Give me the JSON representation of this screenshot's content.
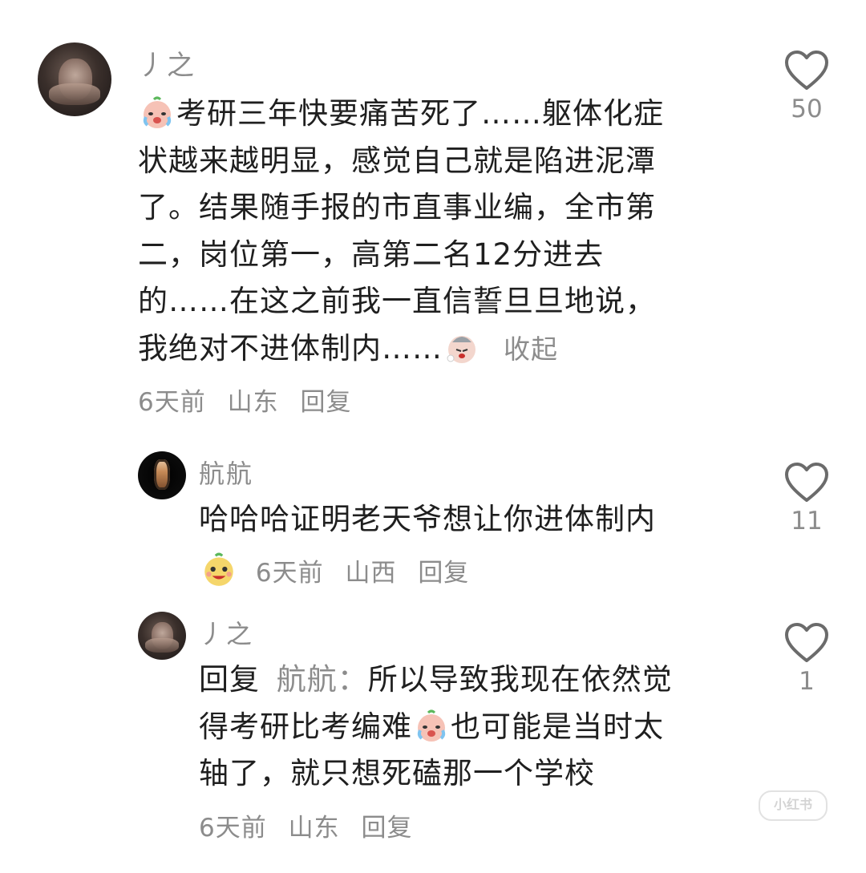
{
  "comments": [
    {
      "username": "丿之",
      "text_lines": [
        "考研三年快要痛苦死了……躯体化症",
        "状越来越明显，感觉自己就是陷进泥潭",
        "了。结果随手报的市直事业编，全市第",
        "二，岗位第一，高第二名12分进去",
        "的……在这之前我一直信誓旦旦地说，",
        "我绝对不进体制内……"
      ],
      "collapse_label": "收起",
      "time": "6天前",
      "location": "山东",
      "reply_label": "回复",
      "likes": "50"
    },
    {
      "username": "航航",
      "text": "哈哈哈证明老天爷想让你进体制内",
      "time": "6天前",
      "location": "山西",
      "reply_label": "回复",
      "likes": "11"
    },
    {
      "username": "丿之",
      "reply_prefix": "回复",
      "reply_to": "航航：",
      "text_lines": [
        "所以导致我现在依然觉",
        "得考研比考编难",
        "也可能是当时太",
        "轴了，就只想死磕那一个学校"
      ],
      "time": "6天前",
      "location": "山东",
      "reply_label": "回复",
      "likes": "1"
    }
  ],
  "watermark": "小红书",
  "icons": {
    "like": "heart-outline-icon",
    "emoji_cry": "crying-face-emoji-icon",
    "emoji_tired": "tired-face-emoji-icon",
    "emoji_laugh": "grinning-face-emoji-icon"
  },
  "colors": {
    "text": "#1f1f1f",
    "muted": "#8c8c8c"
  }
}
